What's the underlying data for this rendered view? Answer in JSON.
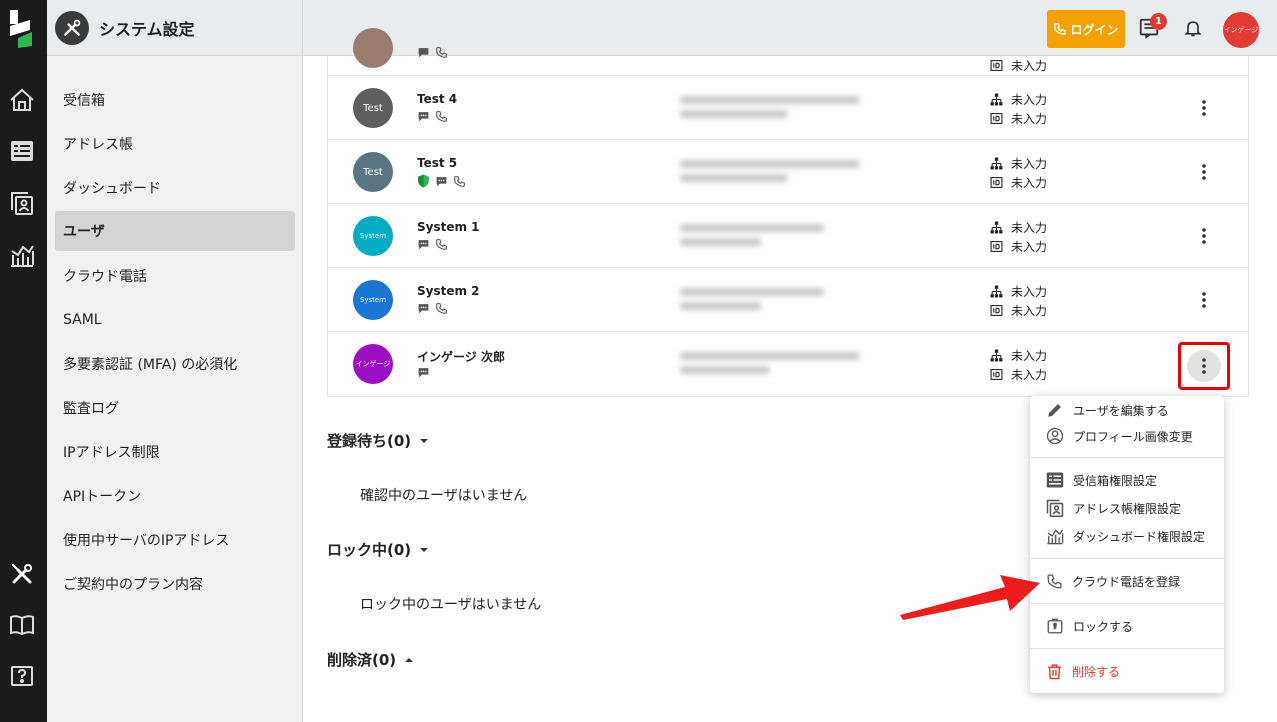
{
  "header": {
    "title": "システム設定",
    "login_label": "ログイン",
    "notification_count": "1",
    "avatar_label": "インゲージ"
  },
  "sidebar": {
    "items": [
      {
        "label": "受信箱"
      },
      {
        "label": "アドレス帳"
      },
      {
        "label": "ダッシュボード"
      },
      {
        "label": "ユーザ",
        "active": true
      },
      {
        "label": "クラウド電話"
      },
      {
        "label": "SAML"
      },
      {
        "label": "多要素認証 (MFA) の必須化"
      },
      {
        "label": "監査ログ"
      },
      {
        "label": "IPアドレス制限"
      },
      {
        "label": "APIトークン"
      },
      {
        "label": "使用中サーバのIPアドレス"
      },
      {
        "label": "ご契約中のプラン内容"
      }
    ]
  },
  "users": [
    {
      "name": "Test 4",
      "avatar_text": "Test",
      "avatar_color": "#5f5f5f",
      "dept": "未入力",
      "id": "未入力"
    },
    {
      "name": "Test 5",
      "avatar_text": "Test",
      "avatar_color": "#5b7583",
      "dept": "未入力",
      "id": "未入力"
    },
    {
      "name": "System 1",
      "avatar_text": "System",
      "avatar_color": "#00acc1",
      "dept": "未入力",
      "id": "未入力"
    },
    {
      "name": "System 2",
      "avatar_text": "System",
      "avatar_color": "#1976d2",
      "dept": "未入力",
      "id": "未入力"
    },
    {
      "name": "インゲージ 次郎",
      "avatar_text": "インゲージ",
      "avatar_color": "#9c0fc2",
      "dept": "未入力",
      "id": "未入力"
    }
  ],
  "partial_row": {
    "dept": "未入力"
  },
  "sections": {
    "pending_title": "登録待ち(0)",
    "pending_empty": "確認中のユーザはいません",
    "locked_title": "ロック中(0)",
    "locked_empty": "ロック中のユーザはいません",
    "deleted_title": "削除済(0)"
  },
  "menu": {
    "edit_user": "ユーザを編集する",
    "change_avatar": "プロフィール画像変更",
    "inbox_perm": "受信箱権限設定",
    "address_perm": "アドレス帳権限設定",
    "dashboard_perm": "ダッシュボード権限設定",
    "register_phone": "クラウド電話を登録",
    "lock": "ロックする",
    "delete": "削除する"
  },
  "colors": {
    "accent_orange": "#f4a000",
    "danger": "#e53935",
    "highlight": "#ee0000"
  }
}
